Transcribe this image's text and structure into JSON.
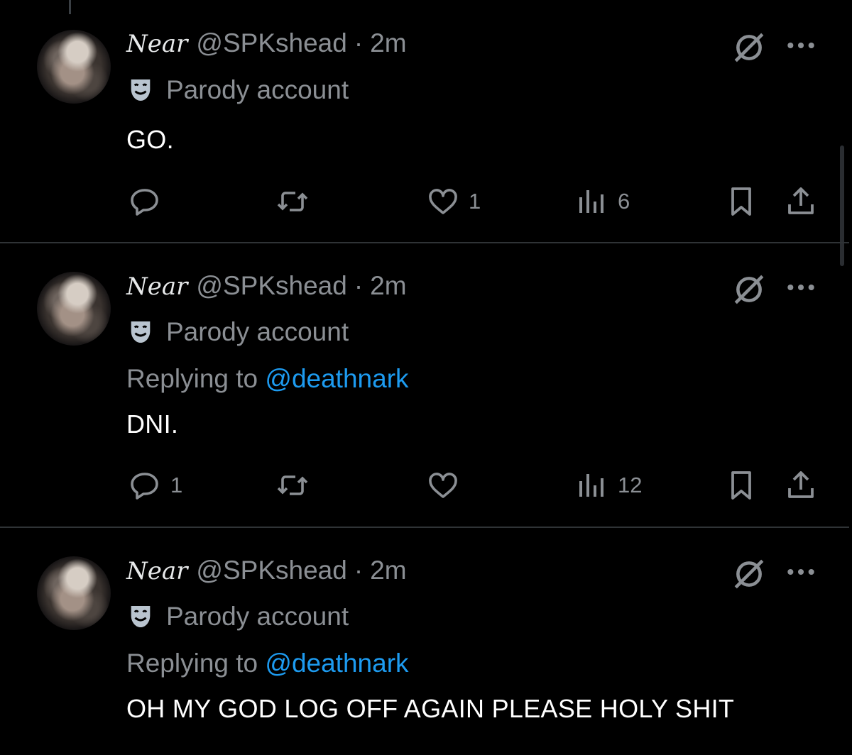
{
  "posts": [
    {
      "display_name": "Near",
      "handle": "@SPKshead",
      "separator": "·",
      "time": "2m",
      "label": "Parody account",
      "replying_prefix": "",
      "replying_to": "",
      "text": "GO.",
      "replies": "",
      "likes": "1",
      "views": "6"
    },
    {
      "display_name": "Near",
      "handle": "@SPKshead",
      "separator": "·",
      "time": "2m",
      "label": "Parody account",
      "replying_prefix": "Replying to",
      "replying_to": "@deathnark",
      "text": "DNI.",
      "replies": "1",
      "likes": "",
      "views": "12"
    },
    {
      "display_name": "Near",
      "handle": "@SPKshead",
      "separator": "·",
      "time": "2m",
      "label": "Parody account",
      "replying_prefix": "Replying to",
      "replying_to": "@deathnark",
      "text": "OH MY GOD LOG OFF AGAIN PLEASE HOLY SHIT"
    }
  ],
  "icons": {
    "parody": "theater-mask-icon",
    "grok": "grok-icon",
    "more": "more-icon",
    "reply": "reply-icon",
    "repost": "repost-icon",
    "like": "like-icon",
    "views": "views-icon",
    "bookmark": "bookmark-icon",
    "share": "share-icon"
  },
  "colors": {
    "background": "#000000",
    "muted": "#8b8f94",
    "link": "#1d9bf0",
    "divider": "#2f3336"
  }
}
